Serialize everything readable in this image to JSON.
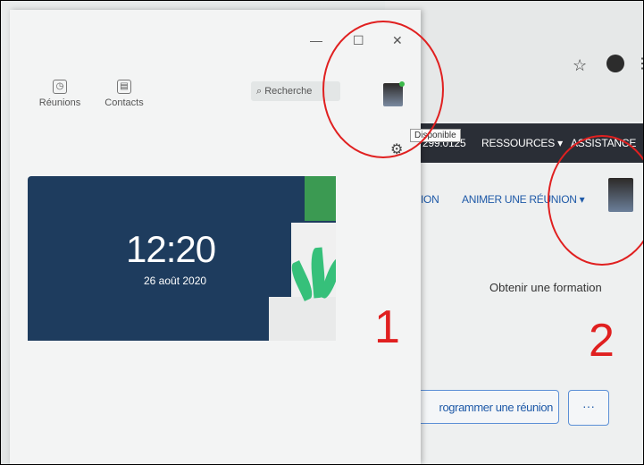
{
  "app": {
    "nav": [
      {
        "label": "Réunions",
        "icon": "clock-icon"
      },
      {
        "label": "Contacts",
        "icon": "contacts-icon"
      }
    ],
    "search_placeholder": "Recherche",
    "window_controls": {
      "maximize": "☐",
      "close": "✕",
      "minimize": "—"
    },
    "status_tooltip": "Disponible",
    "hero": {
      "time": "12:20",
      "date": "26 août 2020"
    }
  },
  "browser": {
    "partial_url": "299.0125",
    "nav": {
      "resources": "RESSOURCES ▾",
      "assistance": "ASSISTANCE"
    },
    "subnav": {
      "partial": "ION",
      "host": "ANIMER UNE RÉUNION ▾"
    },
    "obtain": "Obtenir une formation",
    "schedule_btn": "rogrammer une réunion",
    "more_btn": "···"
  },
  "annotations": {
    "one": "1",
    "two": "2"
  },
  "colors": {
    "accent_red": "#e02020",
    "hero_bg": "#1e3c5e",
    "link_blue": "#1f5aa8"
  }
}
